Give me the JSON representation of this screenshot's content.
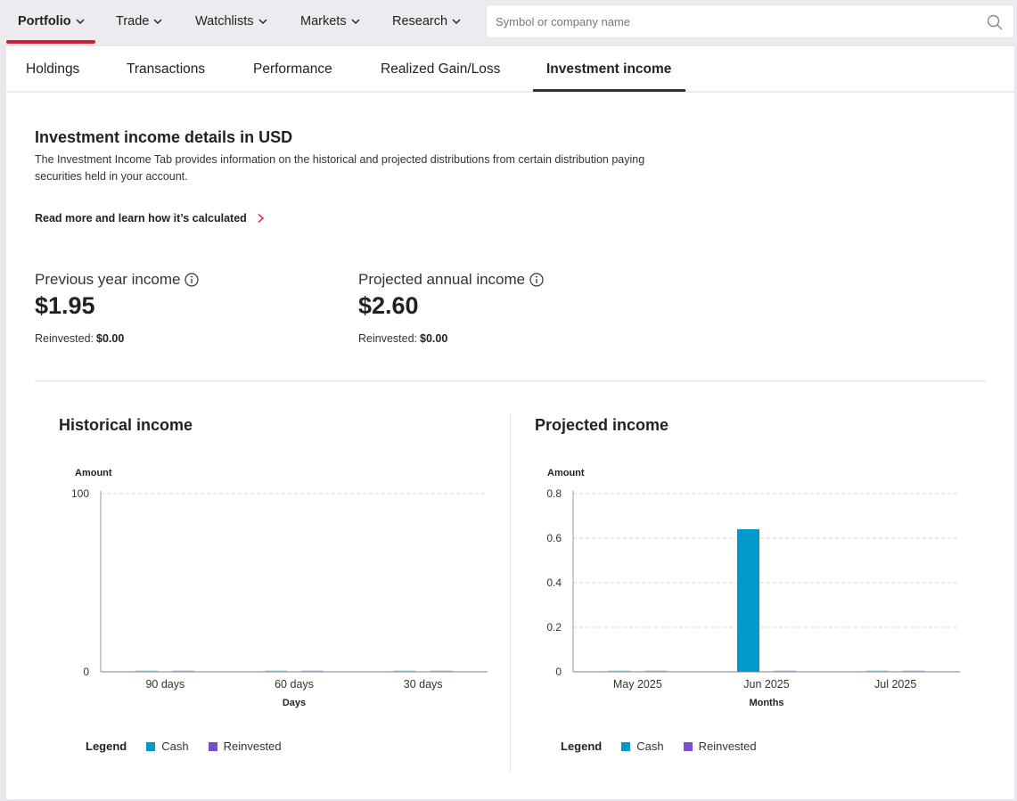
{
  "nav": {
    "items": [
      {
        "label": "Portfolio"
      },
      {
        "label": "Trade"
      },
      {
        "label": "Watchlists"
      },
      {
        "label": "Markets"
      },
      {
        "label": "Research"
      }
    ],
    "search_placeholder": "Symbol or company name"
  },
  "tabs": [
    {
      "label": "Holdings"
    },
    {
      "label": "Transactions"
    },
    {
      "label": "Performance"
    },
    {
      "label": "Realized Gain/Loss"
    },
    {
      "label": "Investment income"
    }
  ],
  "section": {
    "title": "Investment income details in USD",
    "description": "The Investment Income Tab provides information on the historical and projected distributions from certain distribution paying securities held in your account.",
    "read_more": "Read more and learn how it’s calculated"
  },
  "stats": {
    "previous": {
      "label": "Previous year income",
      "value": "$1.95",
      "reinvested_label": "Reinvested:",
      "reinvested_value": "$0.00"
    },
    "projected": {
      "label": "Projected annual income",
      "value": "$2.60",
      "reinvested_label": "Reinvested:",
      "reinvested_value": "$0.00"
    }
  },
  "legend": {
    "title": "Legend",
    "cash": "Cash",
    "reinvested": "Reinvested"
  },
  "colors": {
    "accent": "#d1202f",
    "cash": "#0099cc",
    "reinvested": "#7b4fc9"
  },
  "chart_data": [
    {
      "type": "bar",
      "title": "Historical income",
      "ylabel": "Amount",
      "xlabel": "Days",
      "categories": [
        "90 days",
        "60 days",
        "30 days"
      ],
      "ylim": [
        0,
        100
      ],
      "yticks": [
        "100",
        "0"
      ],
      "grid": true,
      "legend_position": "bottom-left",
      "series": [
        {
          "name": "Cash",
          "values": [
            0,
            0,
            0
          ]
        },
        {
          "name": "Reinvested",
          "values": [
            0,
            0,
            0
          ]
        }
      ]
    },
    {
      "type": "bar",
      "title": "Projected income",
      "ylabel": "Amount",
      "xlabel": "Months",
      "categories": [
        "May 2025",
        "Jun 2025",
        "Jul 2025"
      ],
      "ylim": [
        0,
        0.8
      ],
      "yticks": [
        "0.8",
        "0.6",
        "0.4",
        "0.2",
        "0"
      ],
      "grid": true,
      "legend_position": "bottom-left",
      "series": [
        {
          "name": "Cash",
          "values": [
            0,
            0.64,
            0
          ]
        },
        {
          "name": "Reinvested",
          "values": [
            0,
            0,
            0
          ]
        }
      ]
    }
  ]
}
